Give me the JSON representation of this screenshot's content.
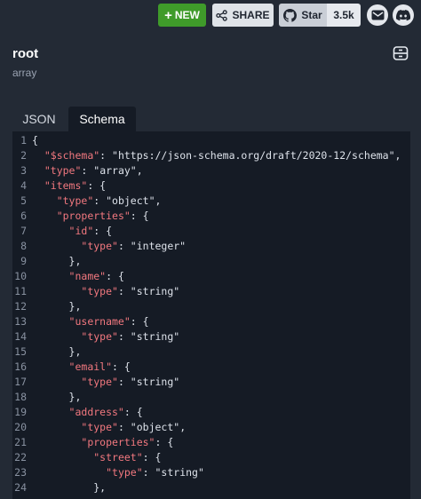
{
  "toolbar": {
    "new_label": "NEW",
    "share_label": "SHARE",
    "star_label": "Star",
    "star_count": "3.5k"
  },
  "header": {
    "title": "root",
    "subtitle": "array"
  },
  "tabs": [
    "JSON",
    "Schema"
  ],
  "active_tab": "Schema",
  "colors": {
    "background": "#232a35",
    "editor_bg": "#151b25",
    "key": "#f2787f",
    "string": "#dde2ea",
    "new_button": "#3f9b2a"
  },
  "code_lines": [
    [
      [
        "p",
        "{"
      ]
    ],
    [
      [
        "p",
        "  "
      ],
      [
        "k",
        "\"$schema\""
      ],
      [
        "p",
        ": "
      ],
      [
        "s",
        "\"https://json-schema.org/draft/2020-12/schema\""
      ],
      [
        "p",
        ","
      ]
    ],
    [
      [
        "p",
        "  "
      ],
      [
        "k",
        "\"type\""
      ],
      [
        "p",
        ": "
      ],
      [
        "s",
        "\"array\""
      ],
      [
        "p",
        ","
      ]
    ],
    [
      [
        "p",
        "  "
      ],
      [
        "k",
        "\"items\""
      ],
      [
        "p",
        ": {"
      ]
    ],
    [
      [
        "p",
        "    "
      ],
      [
        "k",
        "\"type\""
      ],
      [
        "p",
        ": "
      ],
      [
        "s",
        "\"object\""
      ],
      [
        "p",
        ","
      ]
    ],
    [
      [
        "p",
        "    "
      ],
      [
        "k",
        "\"properties\""
      ],
      [
        "p",
        ": {"
      ]
    ],
    [
      [
        "p",
        "      "
      ],
      [
        "k",
        "\"id\""
      ],
      [
        "p",
        ": {"
      ]
    ],
    [
      [
        "p",
        "        "
      ],
      [
        "k",
        "\"type\""
      ],
      [
        "p",
        ": "
      ],
      [
        "s",
        "\"integer\""
      ]
    ],
    [
      [
        "p",
        "      },"
      ]
    ],
    [
      [
        "p",
        "      "
      ],
      [
        "k",
        "\"name\""
      ],
      [
        "p",
        ": {"
      ]
    ],
    [
      [
        "p",
        "        "
      ],
      [
        "k",
        "\"type\""
      ],
      [
        "p",
        ": "
      ],
      [
        "s",
        "\"string\""
      ]
    ],
    [
      [
        "p",
        "      },"
      ]
    ],
    [
      [
        "p",
        "      "
      ],
      [
        "k",
        "\"username\""
      ],
      [
        "p",
        ": {"
      ]
    ],
    [
      [
        "p",
        "        "
      ],
      [
        "k",
        "\"type\""
      ],
      [
        "p",
        ": "
      ],
      [
        "s",
        "\"string\""
      ]
    ],
    [
      [
        "p",
        "      },"
      ]
    ],
    [
      [
        "p",
        "      "
      ],
      [
        "k",
        "\"email\""
      ],
      [
        "p",
        ": {"
      ]
    ],
    [
      [
        "p",
        "        "
      ],
      [
        "k",
        "\"type\""
      ],
      [
        "p",
        ": "
      ],
      [
        "s",
        "\"string\""
      ]
    ],
    [
      [
        "p",
        "      },"
      ]
    ],
    [
      [
        "p",
        "      "
      ],
      [
        "k",
        "\"address\""
      ],
      [
        "p",
        ": {"
      ]
    ],
    [
      [
        "p",
        "        "
      ],
      [
        "k",
        "\"type\""
      ],
      [
        "p",
        ": "
      ],
      [
        "s",
        "\"object\""
      ],
      [
        "p",
        ","
      ]
    ],
    [
      [
        "p",
        "        "
      ],
      [
        "k",
        "\"properties\""
      ],
      [
        "p",
        ": {"
      ]
    ],
    [
      [
        "p",
        "          "
      ],
      [
        "k",
        "\"street\""
      ],
      [
        "p",
        ": {"
      ]
    ],
    [
      [
        "p",
        "            "
      ],
      [
        "k",
        "\"type\""
      ],
      [
        "p",
        ": "
      ],
      [
        "s",
        "\"string\""
      ]
    ],
    [
      [
        "p",
        "          },"
      ]
    ]
  ]
}
